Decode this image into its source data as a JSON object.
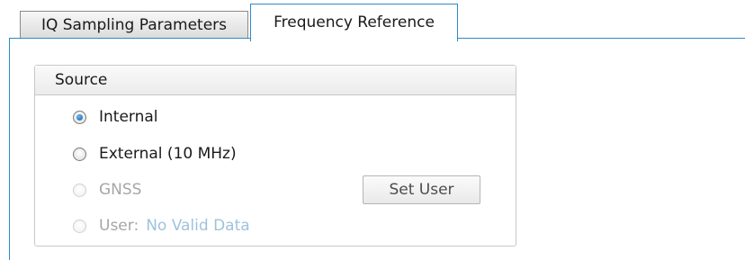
{
  "tabs": [
    {
      "label": "IQ Sampling Parameters",
      "active": false
    },
    {
      "label": "Frequency Reference",
      "active": true
    }
  ],
  "source_group": {
    "title": "Source",
    "options": [
      {
        "label": "Internal",
        "checked": true,
        "enabled": true
      },
      {
        "label": "External (10 MHz)",
        "checked": false,
        "enabled": true
      },
      {
        "label": "GNSS",
        "checked": false,
        "enabled": false
      },
      {
        "label": "User:",
        "value": "No Valid Data",
        "checked": false,
        "enabled": false
      }
    ],
    "set_user_button": "Set User"
  },
  "colors": {
    "tab_border_active": "#2d8bc7",
    "radio_checked": "#1f6fb5",
    "disabled_text": "#a6a6a6",
    "disabled_value_text": "#9ec3dc"
  }
}
